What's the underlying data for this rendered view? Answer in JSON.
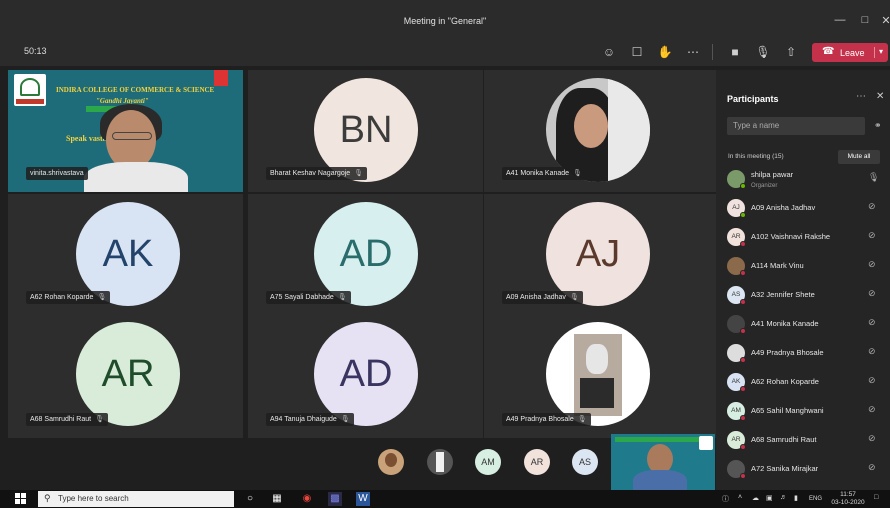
{
  "window": {
    "title": "Meeting in \"General\"",
    "controls": [
      "—",
      "□",
      "✕"
    ]
  },
  "toolbar": {
    "timer": "50:13",
    "leave_label": "Leave"
  },
  "tiles": [
    {
      "kind": "presenter",
      "name": "vinita.shrivastava",
      "college": "INDIRA COLLEGE OF COMMERCE & SCIENCE",
      "event": "\"Gandhi Jayanti\"",
      "speaker_text": "Speak           vastava",
      "logo_text": "INDIRA"
    },
    {
      "kind": "initials",
      "initials": "BN",
      "name": "Bharat Keshav Nagargoje",
      "bg": "#f1e6df",
      "fg": "#3c3c3c"
    },
    {
      "kind": "photo",
      "name": "A41 Monika Kanade"
    },
    {
      "kind": "initials",
      "initials": "AK",
      "name": "A62 Rohan Koparde",
      "bg": "#d8e4f3",
      "fg": "#24436b"
    },
    {
      "kind": "initials",
      "initials": "AD",
      "name": "A75 Sayali Dabhade",
      "bg": "#d7efef",
      "fg": "#2a6b6b"
    },
    {
      "kind": "initials",
      "initials": "AJ",
      "name": "A09 Anisha Jadhav",
      "bg": "#f0e3df",
      "fg": "#5b3a2e"
    },
    {
      "kind": "initials",
      "initials": "AR",
      "name": "A68 Samrudhi Raut",
      "bg": "#d9ecd9",
      "fg": "#1f4d2b"
    },
    {
      "kind": "initials",
      "initials": "AD",
      "name": "A94 Tanuja Dhaigude",
      "bg": "#e6e2f3",
      "fg": "#3a3560"
    },
    {
      "kind": "photo2",
      "name": "A49 Pradnya Bhosale"
    }
  ],
  "strip": [
    {
      "initials": "",
      "bg": "#c9a27a",
      "photo": true
    },
    {
      "initials": "",
      "bg": "#555",
      "photo": true
    },
    {
      "initials": "AM",
      "bg": "#d7efe3"
    },
    {
      "initials": "AR",
      "bg": "#f1e2dc"
    },
    {
      "initials": "AS",
      "bg": "#dce6f3"
    }
  ],
  "panel": {
    "title": "Participants",
    "search_placeholder": "Type a name",
    "in_meeting": "In this meeting (15)",
    "mute_all": "Mute all",
    "participants": [
      {
        "name": "shilpa pawar",
        "sub": "Organizer",
        "initials": "",
        "bg": "#7a9a6a",
        "dot": "#6bb700",
        "mic": "🎙"
      },
      {
        "name": "A09 Anisha Jadhav",
        "sub": "",
        "initials": "AJ",
        "bg": "#f0e3df",
        "dot": "#6bb700",
        "mic": "⊘"
      },
      {
        "name": "A102 Vaishnavi Rakshe",
        "sub": "",
        "initials": "AR",
        "bg": "#f1e2dc",
        "dot": "#c4314b",
        "mic": "⊘"
      },
      {
        "name": "A114 Mark Vinu",
        "sub": "",
        "initials": "",
        "bg": "#8a6a4a",
        "dot": "#c4314b",
        "mic": "⊘"
      },
      {
        "name": "A32 Jennifer Shete",
        "sub": "",
        "initials": "AS",
        "bg": "#dce6f3",
        "dot": "#c4314b",
        "mic": "⊘"
      },
      {
        "name": "A41 Monika Kanade",
        "sub": "",
        "initials": "",
        "bg": "#444",
        "dot": "#c4314b",
        "mic": "⊘"
      },
      {
        "name": "A49 Pradnya Bhosale",
        "sub": "",
        "initials": "",
        "bg": "#ddd",
        "dot": "#c4314b",
        "mic": "⊘"
      },
      {
        "name": "A62 Rohan Koparde",
        "sub": "",
        "initials": "AK",
        "bg": "#d8e4f3",
        "dot": "#c4314b",
        "mic": "⊘"
      },
      {
        "name": "A65 Sahil Manghwani",
        "sub": "",
        "initials": "AM",
        "bg": "#d7efe3",
        "dot": "#c4314b",
        "mic": "⊘"
      },
      {
        "name": "A68 Samrudhi Raut",
        "sub": "",
        "initials": "AR",
        "bg": "#d9ecd9",
        "dot": "#c4314b",
        "mic": "⊘"
      },
      {
        "name": "A72 Sanika Mirajkar",
        "sub": "",
        "initials": "",
        "bg": "#555",
        "dot": "#c4314b",
        "mic": "⊘"
      }
    ]
  },
  "taskbar": {
    "search_placeholder": "Type here to search",
    "language": "ENG",
    "time": "11:57",
    "date": "03-10-2020"
  },
  "colors": {
    "leave": "#c4314b",
    "panel_bg": "#252525",
    "grid_bg": "#2d2d2d"
  }
}
